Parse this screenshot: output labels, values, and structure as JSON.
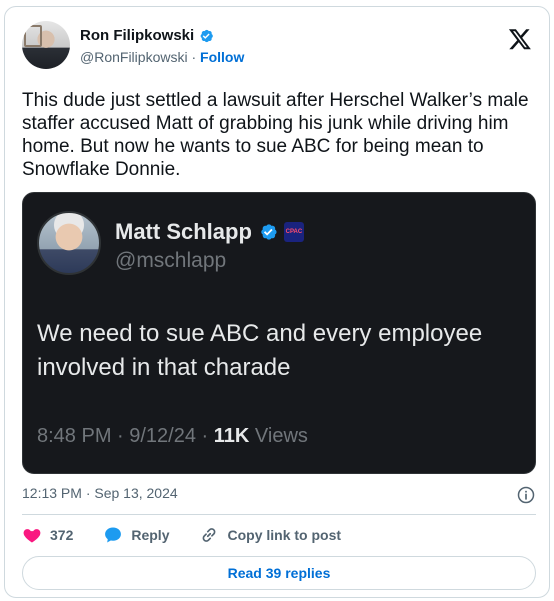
{
  "author": {
    "display_name": "Ron Filipkowski",
    "handle": "@RonFilipkowski",
    "separator": "·",
    "follow_label": "Follow"
  },
  "tweet": {
    "text": "This dude just settled a lawsuit after Herschel Walker’s male staffer accused Matt of grabbing his junk while driving him home. But now he wants to sue ABC for being mean to Snowflake Donnie.",
    "timestamp": "12:13 PM · Sep 13, 2024"
  },
  "quoted": {
    "display_name": "Matt Schlapp",
    "handle": "@mschlapp",
    "badge_text": "CPAC",
    "text": "We need to sue ABC and every employee involved in that charade",
    "time": "8:48 PM · 9/12/24 · ",
    "views_count": "11K",
    "views_label": " Views"
  },
  "actions": {
    "like_count": "372",
    "reply_label": "Reply",
    "copy_label": "Copy link to post"
  },
  "read_replies_label": "Read 39 replies",
  "colors": {
    "like": "#f91880",
    "link": "#006fd6",
    "verified": "#1d9bf0",
    "quote_bg": "#16181c"
  },
  "icons": [
    "x-logo-icon",
    "verified-badge-icon",
    "heart-icon",
    "reply-bubble-icon",
    "link-icon",
    "info-icon"
  ]
}
